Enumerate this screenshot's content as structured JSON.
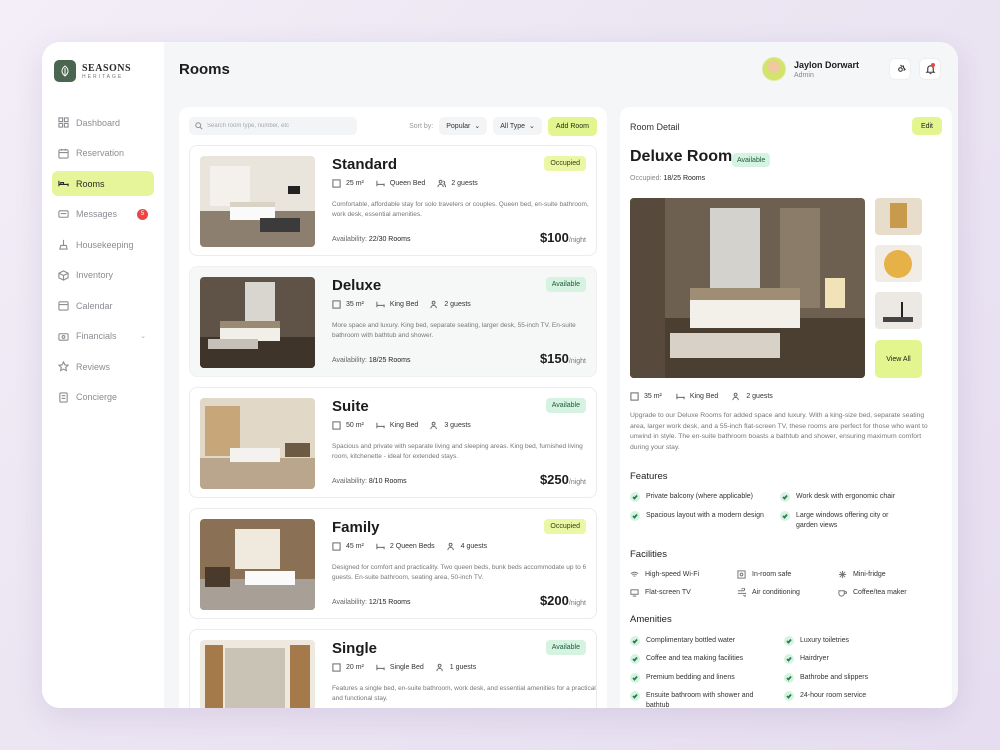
{
  "brand": {
    "name": "SEASONS",
    "sub": "HERITAGE"
  },
  "nav": [
    {
      "label": "Dashboard",
      "icon": "grid-icon"
    },
    {
      "label": "Reservation",
      "icon": "calendar-check-icon"
    },
    {
      "label": "Rooms",
      "icon": "bed-icon",
      "active": true
    },
    {
      "label": "Messages",
      "icon": "message-icon",
      "badge": "5"
    },
    {
      "label": "Housekeeping",
      "icon": "broom-icon"
    },
    {
      "label": "Inventory",
      "icon": "box-icon"
    },
    {
      "label": "Calendar",
      "icon": "calendar-icon"
    },
    {
      "label": "Financials",
      "icon": "wallet-icon",
      "chevron": true
    },
    {
      "label": "Reviews",
      "icon": "star-icon"
    },
    {
      "label": "Concierge",
      "icon": "concierge-icon"
    }
  ],
  "header": {
    "title": "Rooms"
  },
  "user": {
    "name": "Jaylon Dorwart",
    "role": "Admin"
  },
  "toolbar": {
    "search_placeholder": "Search room type, number, etc",
    "sort_label": "Sort by:",
    "sort_value": "Popular",
    "type_value": "All Type",
    "add_label": "Add Room"
  },
  "rooms": [
    {
      "name": "Standard",
      "status": "Occupied",
      "area": "25 m²",
      "bed": "Queen Bed",
      "guests": "2 guests",
      "desc": "Comfortable, affordable stay for solo travelers or couples. Queen bed, en-suite bathroom, work desk, essential amenities.",
      "avail_label": "Availability:",
      "avail": "22/30 Rooms",
      "price": "$100",
      "per": "/night"
    },
    {
      "name": "Deluxe",
      "status": "Available",
      "area": "35 m²",
      "bed": "King Bed",
      "guests": "2 guests",
      "desc": "More space and luxury. King bed, separate seating, larger desk, 55-inch TV. En-suite bathroom with bathtub and shower.",
      "avail_label": "Availability:",
      "avail": "18/25 Rooms",
      "price": "$150",
      "per": "/night"
    },
    {
      "name": "Suite",
      "status": "Available",
      "area": "50 m²",
      "bed": "King Bed",
      "guests": "3 guests",
      "desc": "Spacious and private with separate living and sleeping areas. King bed, furnished living room, kitchenette - ideal for extended stays.",
      "avail_label": "Availability:",
      "avail": "8/10 Rooms",
      "price": "$250",
      "per": "/night"
    },
    {
      "name": "Family",
      "status": "Occupied",
      "area": "45 m²",
      "bed": "2 Queen Beds",
      "guests": "4 guests",
      "desc": "Designed for comfort and practicality. Two queen beds, bunk beds accommodate up to 6 guests. En-suite bathroom, seating area, 50-inch TV.",
      "avail_label": "Availability:",
      "avail": "12/15 Rooms",
      "price": "$200",
      "per": "/night"
    },
    {
      "name": "Single",
      "status": "Available",
      "area": "20 m²",
      "bed": "Single Bed",
      "guests": "1 guests",
      "desc": "Features a single bed, en-suite bathroom, work desk, and essential amenities for a practical and functional stay.",
      "avail_label": "",
      "avail": "",
      "price": "",
      "per": ""
    }
  ],
  "detail": {
    "heading": "Room Detail",
    "edit_label": "Edit",
    "title": "Deluxe Room",
    "status": "Available",
    "occ_label": "Occupied:",
    "occ_value": "18/25 Rooms",
    "view_all": "View All",
    "area": "35 m²",
    "bed": "King Bed",
    "guests": "2 guests",
    "desc": "Upgrade to our Deluxe Rooms for added space and luxury. With a king-size bed, separate seating area, larger work desk, and a 55-inch flat-screen TV, these rooms are perfect for those who want to unwind in style. The en-suite bathroom boasts a bathtub and shower, ensuring maximum comfort during your stay.",
    "features_title": "Features",
    "features": [
      "Private balcony (where applicable)",
      "Work desk with ergonomic chair",
      "Spacious layout with a modern design",
      "Large windows offering city or garden views"
    ],
    "facilities_title": "Facilities",
    "facilities": [
      "High-speed Wi-Fi",
      "In-room safe",
      "Mini-fridge",
      "Flat-screen TV",
      "Air conditioning",
      "Coffee/tea maker"
    ],
    "amenities_title": "Amenities",
    "amenities": [
      "Complimentary bottled water",
      "Luxury toiletries",
      "Coffee and tea making facilities",
      "Hairdryer",
      "Premium bedding and linens",
      "Bathrobe and slippers",
      "Ensuite bathroom with shower and bathtub",
      "24-hour room service"
    ]
  },
  "colors": {
    "accent": "#e3f58f",
    "available_bg": "#d6f3e2",
    "occupied_bg": "#ecf7a6",
    "brand": "#4a6650"
  }
}
